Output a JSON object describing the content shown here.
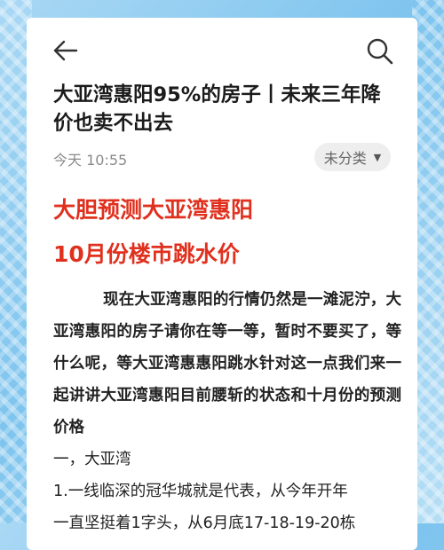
{
  "header": {
    "back_icon": "back-arrow-icon",
    "search_icon": "search-icon"
  },
  "article": {
    "title": "大亚湾惠阳95%的房子丨未来三年降价也卖不出去",
    "date": "今天 10:55",
    "category": "未分类",
    "category_caret": "▼",
    "headline_1": "大胆预测大亚湾惠阳",
    "headline_2": "10月份楼市跳水价",
    "paragraph": "现在大亚湾惠阳的行情仍然是一滩泥泞，大亚湾惠阳的房子请你在等一等，暂时不要买了，等什么呢，等大亚湾惠惠阳跳水针对这一点我们来一起讲讲大亚湾惠阳目前腰斩的状态和十月份的预测价格",
    "section_heading": "一，大亚湾",
    "item_line_1": "1.一线临深的冠华城就是代表，从今年开年",
    "item_line_2": "一直坚挺着1字头，从6月底17-18-19-20栋"
  },
  "colors": {
    "accent_red": "#e0301e",
    "text": "#222222",
    "muted": "#8a8a8a",
    "chip_bg": "#eeeeee"
  }
}
